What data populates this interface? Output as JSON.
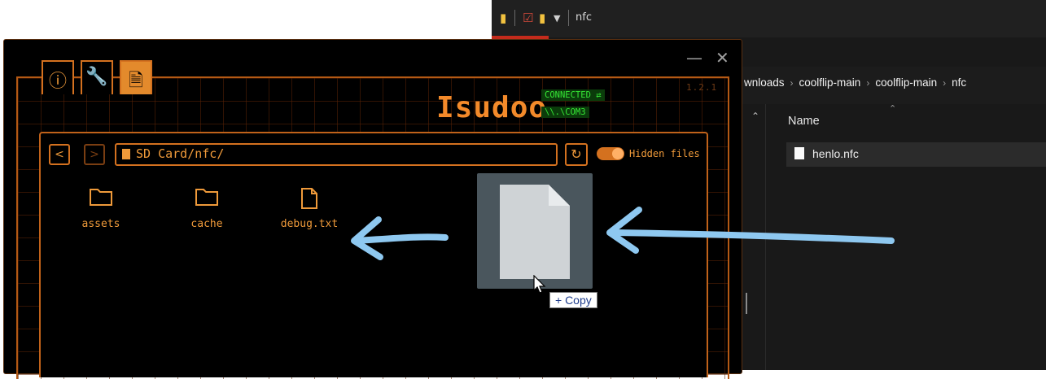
{
  "explorer": {
    "title": "nfc",
    "breadcrumb": [
      "wnloads",
      "coolflip-main",
      "coolflip-main",
      "nfc"
    ],
    "column_name": "Name",
    "files": [
      {
        "name": "henlo.nfc"
      }
    ]
  },
  "app": {
    "version": "1.2.1",
    "brand": "Isudoo",
    "status": "CONNECTED",
    "port": "\\\\.\\COM3",
    "tabs": [
      {
        "icon": "info-icon"
      },
      {
        "icon": "wrench-icon"
      },
      {
        "icon": "file-icon",
        "active": true
      }
    ],
    "path": "SD Card/nfc/",
    "hidden_files_label": "Hidden files",
    "hidden_files_on": true,
    "items": [
      {
        "name": "assets",
        "type": "folder"
      },
      {
        "name": "cache",
        "type": "folder"
      },
      {
        "name": "debug.txt",
        "type": "file"
      }
    ]
  },
  "drag": {
    "tooltip": "+ Copy"
  },
  "colors": {
    "accent": "#e38a2c",
    "status_green": "#35e635",
    "arrow": "#8ec8f0"
  }
}
